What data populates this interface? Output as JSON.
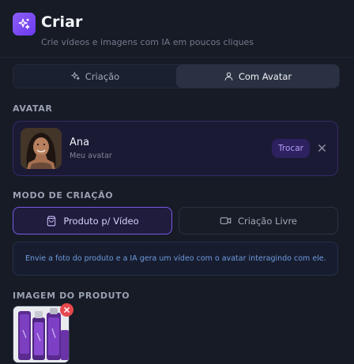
{
  "header": {
    "title": "Criar",
    "subtitle": "Crie vídeos e imagens com IA em poucos cliques",
    "icon": "sparkles-icon"
  },
  "tabs": [
    {
      "label": "Criação",
      "icon": "sparkles-icon",
      "active": false
    },
    {
      "label": "Com Avatar",
      "icon": "user-icon",
      "active": true
    }
  ],
  "avatar_section": {
    "label": "AVATAR",
    "name": "Ana",
    "subtitle": "Meu avatar",
    "swap_label": "Trocar"
  },
  "mode_section": {
    "label": "MODO DE CRIAÇÃO",
    "modes": [
      {
        "label": "Produto p/ Vídeo",
        "icon": "bag-icon",
        "active": true
      },
      {
        "label": "Criação Livre",
        "icon": "video-camera-icon",
        "active": false
      }
    ],
    "info": "Envie a foto do produto e a IA gera um vídeo com o avatar interagindo com ele."
  },
  "product_section": {
    "label": "IMAGEM DO PRODUTO"
  },
  "colors": {
    "background": "#161b26",
    "accent": "#8b5cf6",
    "accent_border": "#7c5ae6",
    "info_text": "#6f9ae0",
    "danger": "#e5484d"
  }
}
